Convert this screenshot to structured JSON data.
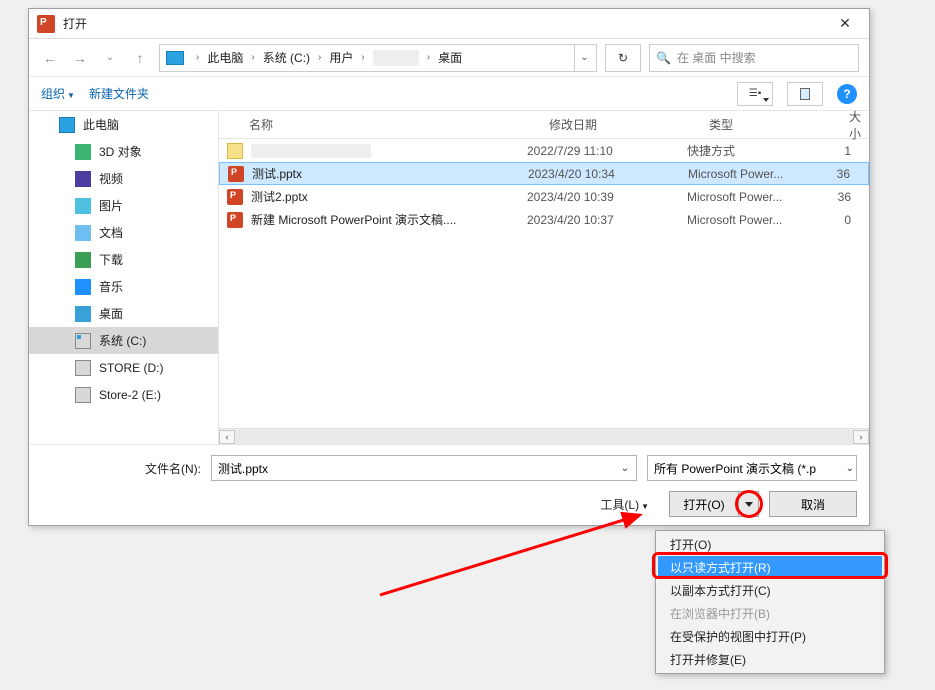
{
  "title": "打开",
  "breadcrumb": {
    "root": "此电脑",
    "drive": "系统 (C:)",
    "users": "用户",
    "desktop": "桌面"
  },
  "search": {
    "placeholder": "在 桌面 中搜索"
  },
  "toolbar": {
    "organize": "组织",
    "newfolder": "新建文件夹"
  },
  "columns": {
    "name": "名称",
    "date": "修改日期",
    "type": "类型",
    "size": "大小"
  },
  "sidebar": {
    "thispc": "此电脑",
    "threed": "3D 对象",
    "videos": "视频",
    "pictures": "图片",
    "documents": "文档",
    "downloads": "下载",
    "music": "音乐",
    "desktop": "桌面",
    "system_c": "系统 (C:)",
    "store_d": "STORE (D:)",
    "store2_e": "Store-2 (E:)"
  },
  "files": [
    {
      "name": "",
      "date": "2022/7/29 11:10",
      "type": "快捷方式",
      "size": "1",
      "icon": "shortcut",
      "blurred": true
    },
    {
      "name": "测试.pptx",
      "date": "2023/4/20 10:34",
      "type": "Microsoft Power...",
      "size": "36",
      "icon": "ppt",
      "selected": true
    },
    {
      "name": "测试2.pptx",
      "date": "2023/4/20 10:39",
      "type": "Microsoft Power...",
      "size": "36",
      "icon": "ppt"
    },
    {
      "name": "新建 Microsoft PowerPoint 演示文稿....",
      "date": "2023/4/20 10:37",
      "type": "Microsoft Power...",
      "size": "0",
      "icon": "ppt"
    }
  ],
  "footer": {
    "filename_label": "文件名(N):",
    "filename_value": "测试.pptx",
    "filetype_label": "所有 PowerPoint 演示文稿 (*.p",
    "tools": "工具(L)",
    "open_btn": "打开(O)",
    "cancel_btn": "取消"
  },
  "open_menu": {
    "open": "打开(O)",
    "readonly": "以只读方式打开(R)",
    "copy": "以副本方式打开(C)",
    "browser": "在浏览器中打开(B)",
    "protected": "在受保护的视图中打开(P)",
    "repair": "打开并修复(E)"
  }
}
